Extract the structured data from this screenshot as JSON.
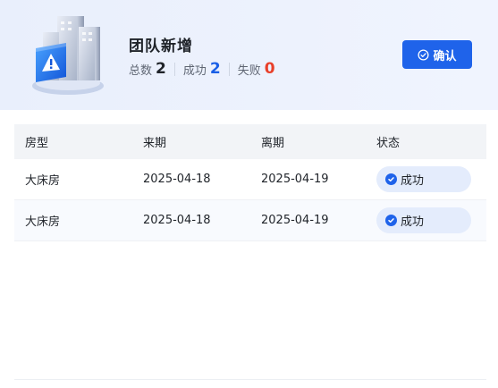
{
  "header": {
    "title": "团队新增",
    "stats": {
      "total_label": "总数",
      "total_value": "2",
      "success_label": "成功",
      "success_value": "2",
      "fail_label": "失败",
      "fail_value": "0"
    },
    "confirm_label": "确认"
  },
  "colors": {
    "accent": "#1f63ea",
    "success_value": "#1a5fe6",
    "fail_value": "#e8402a",
    "badge_bg": "#e4ecfc"
  },
  "table": {
    "columns": [
      "房型",
      "来期",
      "离期",
      "状态"
    ],
    "rows": [
      {
        "room_type": "大床房",
        "arrival": "2025-04-18",
        "departure": "2025-04-19",
        "status": "成功",
        "status_icon": "check-circle-icon"
      },
      {
        "room_type": "大床房",
        "arrival": "2025-04-18",
        "departure": "2025-04-19",
        "status": "成功",
        "status_icon": "check-circle-icon"
      }
    ]
  }
}
